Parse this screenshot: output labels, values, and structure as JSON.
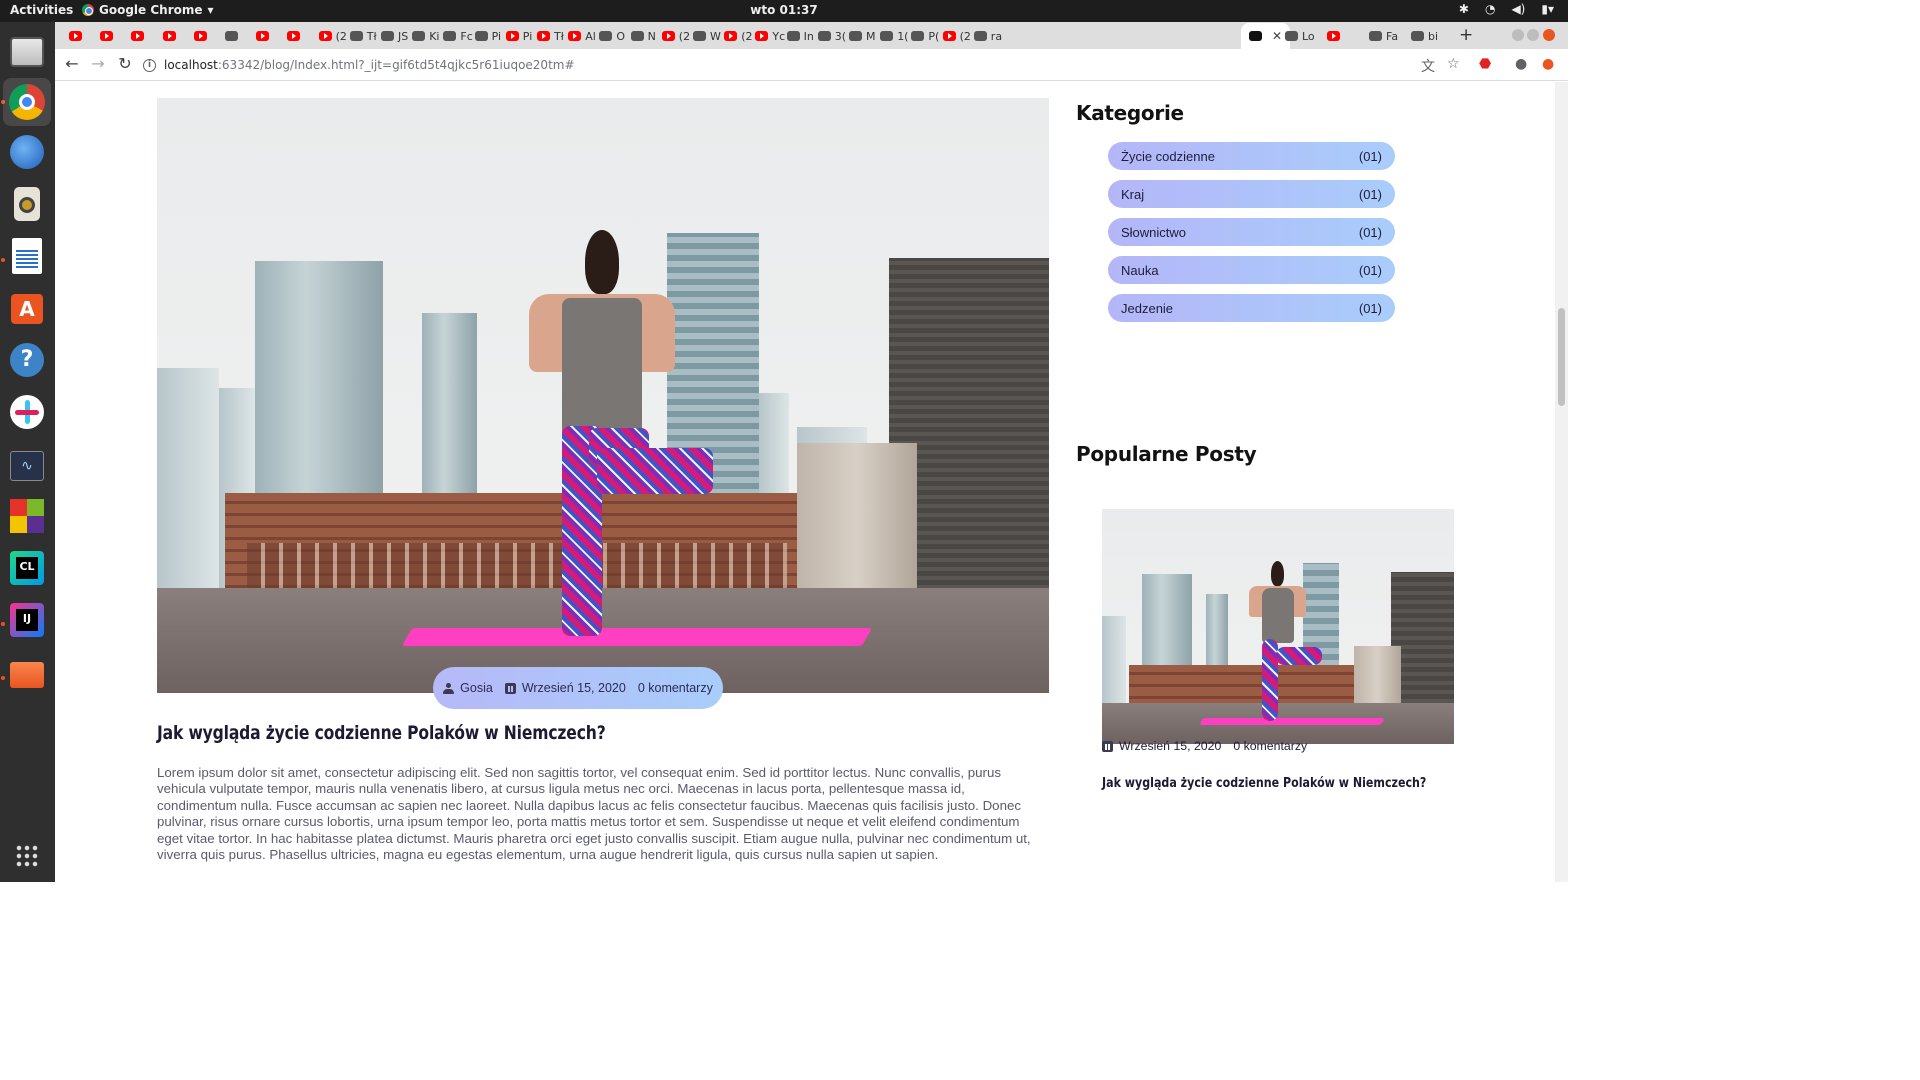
{
  "system": {
    "activities": "Activities",
    "app_name": "Google Chrome",
    "clock": "wto 01:37"
  },
  "tabs": [
    {
      "label": "",
      "icon": "youtube-icon"
    },
    {
      "label": "",
      "icon": "youtube-icon"
    },
    {
      "label": "",
      "icon": "youtube-icon"
    },
    {
      "label": "",
      "icon": "youtube-icon"
    },
    {
      "label": "",
      "icon": "youtube-icon"
    },
    {
      "label": "",
      "icon": "sync-icon"
    },
    {
      "label": "",
      "icon": "youtube-icon"
    },
    {
      "label": "",
      "icon": "youtube-icon"
    },
    {
      "label": "(2",
      "icon": "youtube-icon"
    },
    {
      "label": "Tł",
      "icon": "translate-icon"
    },
    {
      "label": "JS",
      "icon": "site-icon"
    },
    {
      "label": "Ki",
      "icon": "site-icon"
    },
    {
      "label": "Fc",
      "icon": "site-icon"
    },
    {
      "label": "Pi",
      "icon": "site-icon"
    },
    {
      "label": "Pi",
      "icon": "youtube-icon"
    },
    {
      "label": "Tł",
      "icon": "youtube-icon"
    },
    {
      "label": "Al",
      "icon": "youtube-icon"
    },
    {
      "label": "O",
      "icon": "site-icon"
    },
    {
      "label": "N",
      "icon": "netflix-icon"
    },
    {
      "label": "(2",
      "icon": "youtube-icon"
    },
    {
      "label": "W",
      "icon": "site-icon"
    },
    {
      "label": "(2",
      "icon": "youtube-icon"
    },
    {
      "label": "Yc",
      "icon": "youtube-icon"
    },
    {
      "label": "In",
      "icon": "site-icon"
    },
    {
      "label": "3(",
      "icon": "site-icon"
    },
    {
      "label": "M",
      "icon": "site-icon"
    },
    {
      "label": "1(",
      "icon": "site-icon"
    },
    {
      "label": "P(",
      "icon": "gmail-icon"
    },
    {
      "label": "(2",
      "icon": "youtube-icon"
    },
    {
      "label": "ra",
      "icon": "github-icon"
    }
  ],
  "tabs_after_active": [
    {
      "label": "Lo",
      "icon": "site-icon"
    },
    {
      "label": "",
      "icon": "youtube-icon"
    },
    {
      "label": "Fa",
      "icon": "facebook-icon"
    },
    {
      "label": "bi",
      "icon": "google-icon"
    }
  ],
  "address": {
    "host": "localhost",
    "path": ":63342/blog/Index.html?_ijt=gif6td5t4qjkc5r61iuqoe20tm#"
  },
  "post": {
    "author": "Gosia",
    "date": "Wrzesień 15, 2020",
    "comments": "0 komentarzy",
    "title": "Jak wygląda życie codzienne Polaków w Niemczech?",
    "excerpt": "Lorem ipsum dolor sit amet, consectetur adipiscing elit. Sed non sagittis tortor, vel consequat enim. Sed id porttitor lectus. Nunc convallis, purus vehicula vulputate tempor, mauris nulla venenatis libero, at cursus ligula metus nec orci. Maecenas in lacus porta, pellentesque massa id, condimentum nulla. Fusce accumsan ac sapien nec laoreet. Nulla dapibus lacus ac felis consectetur faucibus. Maecenas quis facilisis justo. Donec pulvinar, risus ornare cursus lobortis, urna ipsum tempor leo, porta mattis metus tortor et sem. Suspendisse ut neque et velit eleifend condimentum eget vitae tortor. In hac habitasse platea dictumst. Mauris pharetra orci eget justo convallis suscipit. Etiam augue nulla, pulvinar nec condimentum ut, viverra quis purus. Phasellus ultricies, magna eu egestas elementum, urna augue hendrerit ligula, quis cursus nulla sapien ut sapien."
  },
  "sidebar": {
    "categories_heading": "Kategorie",
    "categories": [
      {
        "name": "Życie codzienne",
        "count": "(01)"
      },
      {
        "name": "Kraj",
        "count": "(01)"
      },
      {
        "name": "Słownictwo",
        "count": "(01)"
      },
      {
        "name": "Nauka",
        "count": "(01)"
      },
      {
        "name": "Jedzenie",
        "count": "(01)"
      }
    ],
    "popular_heading": "Popularne Posty",
    "popular": {
      "date": "Wrzesień 15, 2020",
      "comments": "0 komentarzy",
      "title": "Jak wygląda życie codzienne Polaków w Niemczech?"
    }
  },
  "colors": {
    "pill_start": "#b6b9f8",
    "pill_end": "#a8cdfb",
    "mat": "#ff3fc1",
    "heading": "#1b1b33"
  }
}
